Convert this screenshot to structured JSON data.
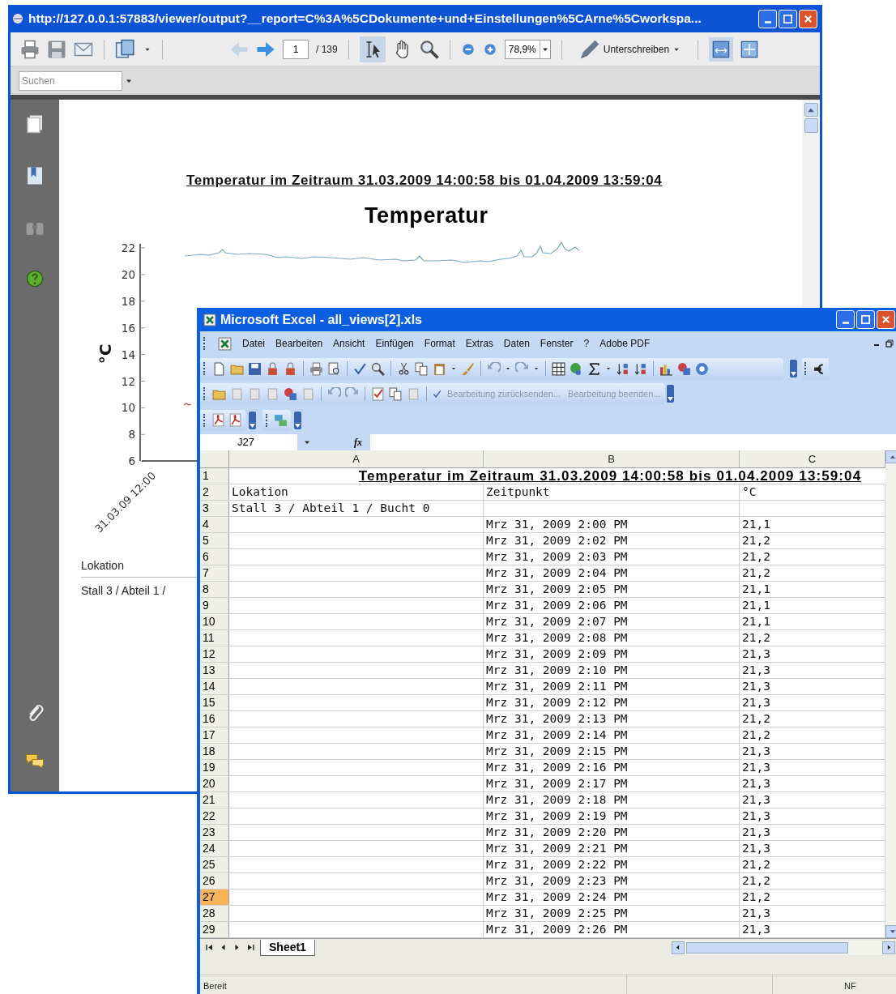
{
  "viewer": {
    "title": "http://127.0.0.1:57883/viewer/output?__report=C%3A%5CDokumente+und+Einstellungen%5CArne%5Cworkspa...",
    "page": "1",
    "page_count": "/ 139",
    "zoom": "78,9%",
    "sign_button": "Unterschreiben",
    "search": {
      "placeholder": "Suchen"
    },
    "document": {
      "heading": "Temperatur im Zeitraum 31.03.2009 14:00:58 bis 01.04.2009 13:59:04",
      "chart_title": "Temperatur",
      "y_label": "°C",
      "y_ticks": [
        "22",
        "20",
        "18",
        "16",
        "14",
        "12",
        "10",
        "8",
        "6"
      ],
      "x_tick": "31.03.09 12:00",
      "table_header": "Lokation",
      "table_row": "Stall 3 / Abteil 1 /"
    }
  },
  "excel": {
    "title": "Microsoft Excel - all_views[2].xls",
    "menu": [
      "Datei",
      "Bearbeiten",
      "Ansicht",
      "Einfügen",
      "Format",
      "Extras",
      "Daten",
      "Fenster",
      "?",
      "Adobe PDF"
    ],
    "review_actions": [
      "Bearbeitung zurücksenden...",
      "Bearbeitung beenden..."
    ],
    "name_box": "J27",
    "formula_label": "fx",
    "columns": [
      "A",
      "B",
      "C"
    ],
    "rows": [
      {
        "number": "1",
        "selected": false,
        "title": "Temperatur im Zeitraum 31.03.2009 14:00:58 bis 01.04.2009 13:59:04"
      },
      {
        "number": "2",
        "selected": false,
        "a": "Lokation",
        "b": "Zeitpunkt",
        "c": "°C"
      },
      {
        "number": "3",
        "selected": false,
        "a": "Stall 3 / Abteil 1 / Bucht 0"
      },
      {
        "number": "4",
        "selected": false,
        "b": "Mrz 31, 2009 2:00 PM",
        "c": "21,1"
      },
      {
        "number": "5",
        "selected": false,
        "b": "Mrz 31, 2009 2:02 PM",
        "c": "21,2"
      },
      {
        "number": "6",
        "selected": false,
        "b": "Mrz 31, 2009 2:03 PM",
        "c": "21,2"
      },
      {
        "number": "7",
        "selected": false,
        "b": "Mrz 31, 2009 2:04 PM",
        "c": "21,2"
      },
      {
        "number": "8",
        "selected": false,
        "b": "Mrz 31, 2009 2:05 PM",
        "c": "21,1"
      },
      {
        "number": "9",
        "selected": false,
        "b": "Mrz 31, 2009 2:06 PM",
        "c": "21,1"
      },
      {
        "number": "10",
        "selected": false,
        "b": "Mrz 31, 2009 2:07 PM",
        "c": "21,1"
      },
      {
        "number": "11",
        "selected": false,
        "b": "Mrz 31, 2009 2:08 PM",
        "c": "21,2"
      },
      {
        "number": "12",
        "selected": false,
        "b": "Mrz 31, 2009 2:09 PM",
        "c": "21,3"
      },
      {
        "number": "13",
        "selected": false,
        "b": "Mrz 31, 2009 2:10 PM",
        "c": "21,3"
      },
      {
        "number": "14",
        "selected": false,
        "b": "Mrz 31, 2009 2:11 PM",
        "c": "21,3"
      },
      {
        "number": "15",
        "selected": false,
        "b": "Mrz 31, 2009 2:12 PM",
        "c": "21,3"
      },
      {
        "number": "16",
        "selected": false,
        "b": "Mrz 31, 2009 2:13 PM",
        "c": "21,2"
      },
      {
        "number": "17",
        "selected": false,
        "b": "Mrz 31, 2009 2:14 PM",
        "c": "21,2"
      },
      {
        "number": "18",
        "selected": false,
        "b": "Mrz 31, 2009 2:15 PM",
        "c": "21,3"
      },
      {
        "number": "19",
        "selected": false,
        "b": "Mrz 31, 2009 2:16 PM",
        "c": "21,3"
      },
      {
        "number": "20",
        "selected": false,
        "b": "Mrz 31, 2009 2:17 PM",
        "c": "21,3"
      },
      {
        "number": "21",
        "selected": false,
        "b": "Mrz 31, 2009 2:18 PM",
        "c": "21,3"
      },
      {
        "number": "22",
        "selected": false,
        "b": "Mrz 31, 2009 2:19 PM",
        "c": "21,3"
      },
      {
        "number": "23",
        "selected": false,
        "b": "Mrz 31, 2009 2:20 PM",
        "c": "21,3"
      },
      {
        "number": "24",
        "selected": false,
        "b": "Mrz 31, 2009 2:21 PM",
        "c": "21,3"
      },
      {
        "number": "25",
        "selected": false,
        "b": "Mrz 31, 2009 2:22 PM",
        "c": "21,2"
      },
      {
        "number": "26",
        "selected": false,
        "b": "Mrz 31, 2009 2:23 PM",
        "c": "21,2"
      },
      {
        "number": "27",
        "selected": true,
        "b": "Mrz 31, 2009 2:24 PM",
        "c": "21,2"
      },
      {
        "number": "28",
        "selected": false,
        "b": "Mrz 31, 2009 2:25 PM",
        "c": "21,3"
      },
      {
        "number": "29",
        "selected": false,
        "b": "Mrz 31, 2009 2:26 PM",
        "c": "21,3"
      }
    ],
    "sheet_tabs": [
      {
        "label": "Sheet1",
        "selected": true
      }
    ],
    "status": "Bereit",
    "status_indicator": "NF"
  }
}
